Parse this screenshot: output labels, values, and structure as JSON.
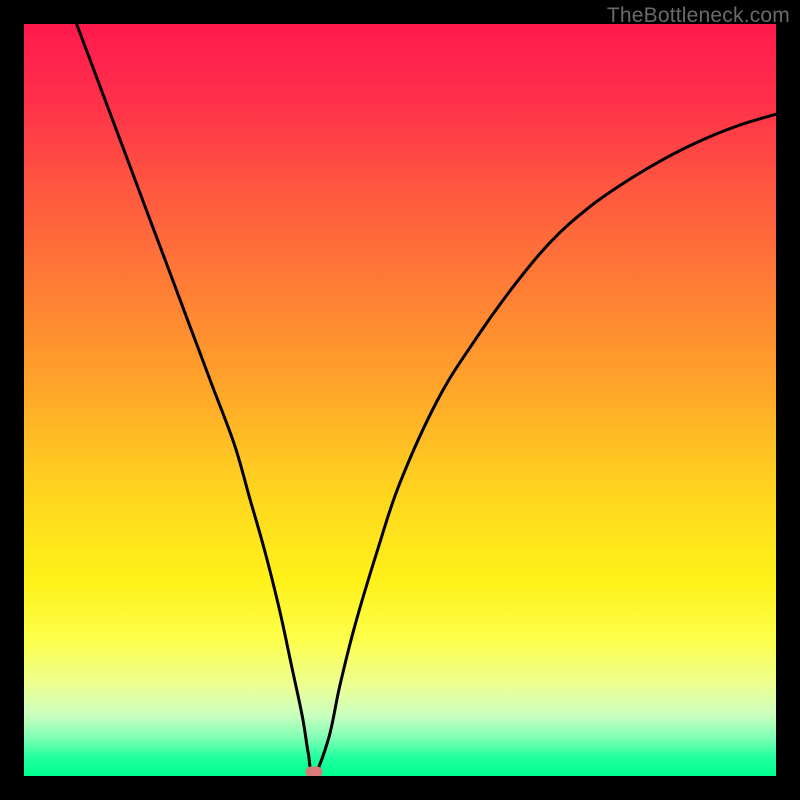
{
  "watermark": "TheBottleneck.com",
  "colors": {
    "gradient_top": "#ff1a4d",
    "gradient_bottom": "#00ff8f",
    "curve": "#000000",
    "marker": "#d97a7a",
    "frame": "#000000"
  },
  "chart_data": {
    "type": "line",
    "title": "",
    "xlabel": "",
    "ylabel": "",
    "xlim": [
      0,
      100
    ],
    "ylim": [
      0,
      100
    ],
    "x": [
      7,
      10,
      13,
      16,
      19,
      22,
      25,
      28,
      30,
      32,
      34,
      35.5,
      37,
      37.8,
      38.5,
      40.5,
      42,
      44,
      47,
      50,
      55,
      60,
      65,
      70,
      75,
      80,
      85,
      90,
      95,
      100
    ],
    "values": [
      100,
      92,
      84,
      76,
      68,
      60,
      52,
      44,
      37,
      30,
      22,
      15,
      8,
      3,
      0,
      5,
      12,
      20,
      30,
      39,
      50,
      58,
      65,
      71,
      75.5,
      79,
      82,
      84.5,
      86.5,
      88
    ],
    "minimum_x": 38.5,
    "marker": {
      "x": 38.5,
      "y": 0
    },
    "note": "V-shaped bottleneck curve; values are estimated from pixel positions (no axis ticks shown); 0 = bottom (green), 100 = top (red)."
  }
}
